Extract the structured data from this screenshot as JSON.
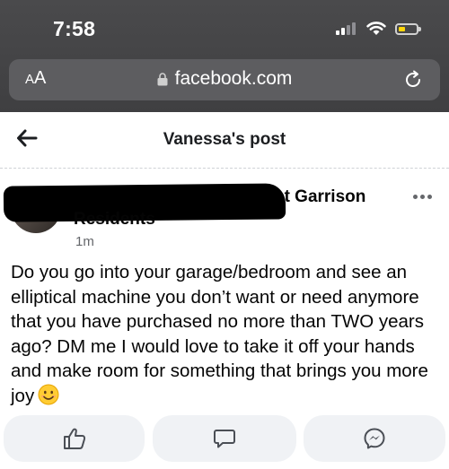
{
  "status_bar": {
    "time": "7:58",
    "battery_level": 0.2,
    "battery_color": "#ffd60a"
  },
  "browser": {
    "aa_label": "AA",
    "url": "facebook.com",
    "lock_icon": "lock-icon",
    "reload_icon": "reload-icon"
  },
  "header": {
    "title": "Vanessa's post",
    "back_icon": "back-arrow-icon"
  },
  "post": {
    "author_line1": "st Garrison",
    "author_line2": "Residents",
    "timestamp": "1m",
    "body": "Do you go into your garage/bedroom and see an elliptical machine you don’t want or need anymore that you have purchased no more than TWO years ago? DM me I would love to take it off your hands and make room for something that brings you more joy",
    "emoji": "smiling-face-emoji"
  },
  "actions": [
    {
      "icon": "like-icon"
    },
    {
      "icon": "comment-icon"
    },
    {
      "icon": "messenger-icon"
    }
  ],
  "colors": {
    "chrome_bg": "#434345",
    "url_bar_bg": "#5d5d60",
    "button_bg": "#f0f2f5",
    "icon_gray": "#65676b"
  }
}
